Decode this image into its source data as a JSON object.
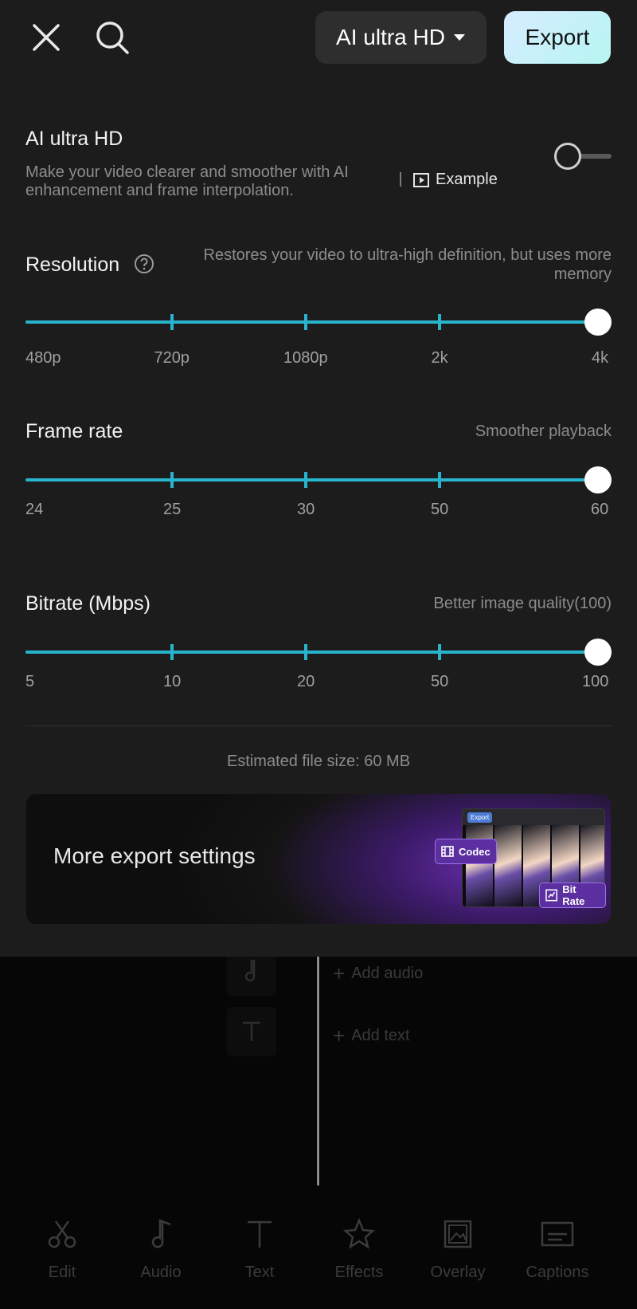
{
  "header": {
    "quality_label": "AI ultra HD",
    "export_label": "Export"
  },
  "ai_section": {
    "title": "AI ultra HD",
    "description": "Make your video clearer and smoother with AI enhancement and frame interpolation.",
    "example_label": "Example",
    "enabled": false
  },
  "resolution": {
    "title": "Resolution",
    "hint": "Restores your video to ultra-high definition, but uses more memory",
    "options": [
      "480p",
      "720p",
      "1080p",
      "2k",
      "4k"
    ],
    "selected": "4k"
  },
  "frame_rate": {
    "title": "Frame rate",
    "hint": "Smoother playback",
    "options": [
      "24",
      "25",
      "30",
      "50",
      "60"
    ],
    "selected": "60"
  },
  "bitrate": {
    "title": "Bitrate (Mbps)",
    "hint": "Better image quality(100)",
    "options": [
      "5",
      "10",
      "20",
      "50",
      "100"
    ],
    "selected": "100"
  },
  "file_size": "Estimated file size: 60 MB",
  "more_settings": {
    "label": "More export settings",
    "promo_export": "Export",
    "promo_codec": "Codec",
    "promo_bitrate": "Bit Rate"
  },
  "editor": {
    "add_audio": "Add audio",
    "add_text": "Add text"
  },
  "bottom_nav": [
    "Edit",
    "Audio",
    "Text",
    "Effects",
    "Overlay",
    "Captions"
  ],
  "colors": {
    "accent": "#27b4cc",
    "panel": "#1c1c1c",
    "export_gradient_start": "#d7ecff",
    "export_gradient_end": "#b6f6f2"
  }
}
